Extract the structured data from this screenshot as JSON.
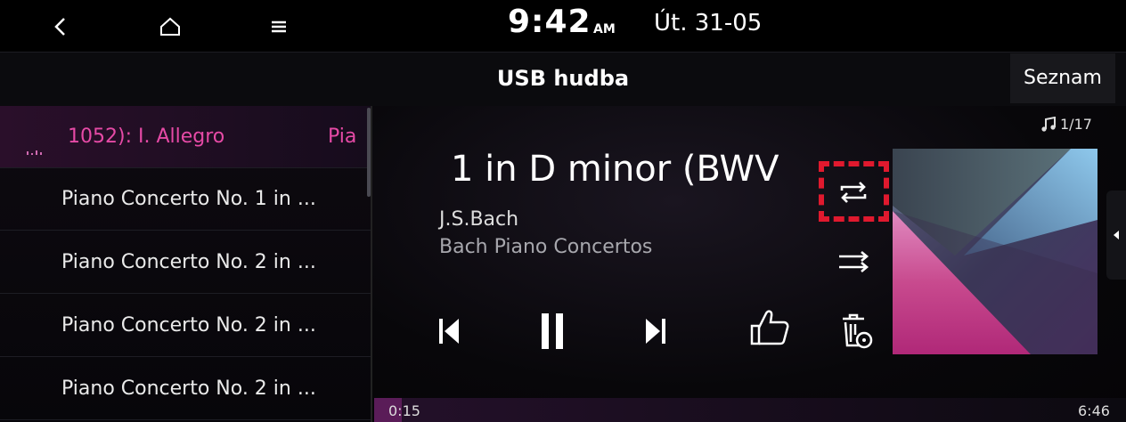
{
  "status": {
    "time": "9:42",
    "ampm": "AM",
    "date": "Út. 31-05"
  },
  "header": {
    "title": "USB hudba",
    "list_button": "Seznam"
  },
  "playlist": {
    "items": [
      {
        "label": "1052): I. Allegro",
        "trailing": "Pia",
        "active": true
      },
      {
        "label": "Piano Concerto No. 1 in ..."
      },
      {
        "label": "Piano Concerto No. 2 in ..."
      },
      {
        "label": "Piano Concerto No. 2 in ..."
      },
      {
        "label": "Piano Concerto No. 2 in ..."
      }
    ]
  },
  "player": {
    "title": "1 in D minor (BWV",
    "artist": "J.S.Bach",
    "album": "Bach Piano Concertos",
    "track_index": "1/17",
    "elapsed": "0:15",
    "duration": "6:46",
    "progress_fraction": 0.037,
    "accent": "#e64aa6",
    "highlight_color": "#e0192e"
  }
}
